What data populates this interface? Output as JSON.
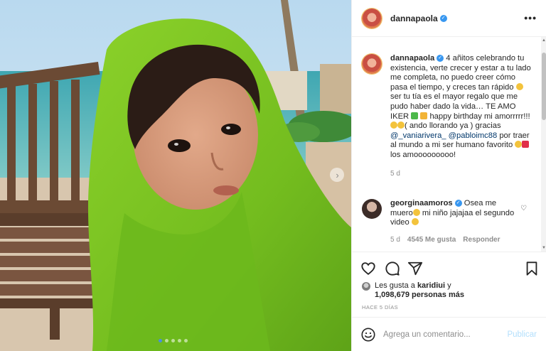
{
  "post": {
    "username": "dannapaola",
    "more_label": "•••"
  },
  "photo": {
    "carousel_total": 5,
    "carousel_active_index": 0,
    "next_icon": "chevron-right-icon"
  },
  "caption": {
    "username": "dannapaola",
    "text_1": "4 añitos celebrando tu existencia, verte crecer y estar a tu lado me completa, no puedo creer cómo pasa el tiempo, y creces tan rápido ",
    "text_2": "ser tu tía es el mayor regalo que me pudo haber dado la vida… TE AMO IKER ",
    "text_3": " happy birthday mi amorrrrr!!! ",
    "text_4": "( ando llorando ya ) gracias ",
    "mention_1": "@_vaniarivera_",
    "mention_2": "@pabloimc88",
    "text_5": " por traer al mundo a mi ser humano favorito ",
    "text_6": "los amooooooooo!",
    "time": "5 d"
  },
  "comment": {
    "username": "georginaamoros",
    "text_1": "Osea me muero",
    "text_2": " mi niño jajajaa el segundo video",
    "time": "5 d",
    "likes": "4545 Me gusta",
    "reply": "Responder",
    "like_icon": "heart-outline-icon"
  },
  "likes": {
    "prefix": "Les gusta a ",
    "user": "karidiui",
    "connector": " y",
    "count": "1,098,679 personas más"
  },
  "ago": "HACE 5 DÍAS",
  "add_comment": {
    "placeholder": "Agrega un comentario...",
    "publish": "Publicar"
  },
  "colors": {
    "verified": "#3897f0",
    "publish_disabled": "#b2dffc",
    "towel": "#7ac223"
  }
}
